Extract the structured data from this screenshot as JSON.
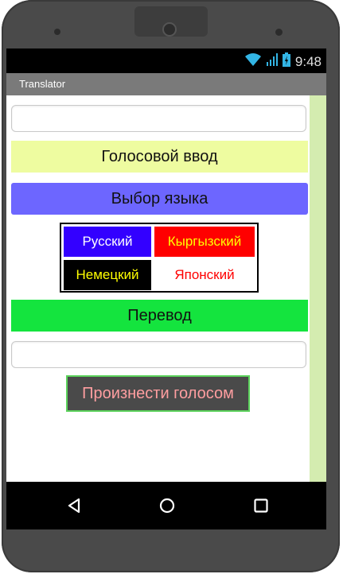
{
  "status": {
    "time": "9:48"
  },
  "app": {
    "title": "Translator"
  },
  "main": {
    "input_top_value": "",
    "voice_input_label": "Голосовой ввод",
    "language_select_label": "Выбор языка",
    "languages": [
      {
        "label": "Русский",
        "bg": "#3300ff",
        "fg": "#ffffff"
      },
      {
        "label": "Кыргызский",
        "bg": "#ff0000",
        "fg": "#ffff00"
      },
      {
        "label": "Немецкий",
        "bg": "#000000",
        "fg": "#ffff00"
      },
      {
        "label": "Японский",
        "bg": "#ffffff",
        "fg": "#ff0000"
      }
    ],
    "translate_label": "Перевод",
    "input_bottom_value": "",
    "speak_label": "Произнести голосом"
  },
  "colors": {
    "voice_input_bg": "#eefca0",
    "language_select_bg": "#6d66ff",
    "translate_bg": "#14e43e",
    "speak_bg": "#4a4a4a",
    "speak_border": "#5cd35c",
    "speak_text": "#ff9ea0",
    "scroll_strip": "#d4ecb0",
    "title_bar": "#7a7a7a"
  },
  "icons": {
    "wifi": "wifi-icon",
    "signal": "signal-icon",
    "battery": "battery-icon",
    "back": "back-icon",
    "home": "home-icon",
    "recents": "recents-icon"
  }
}
